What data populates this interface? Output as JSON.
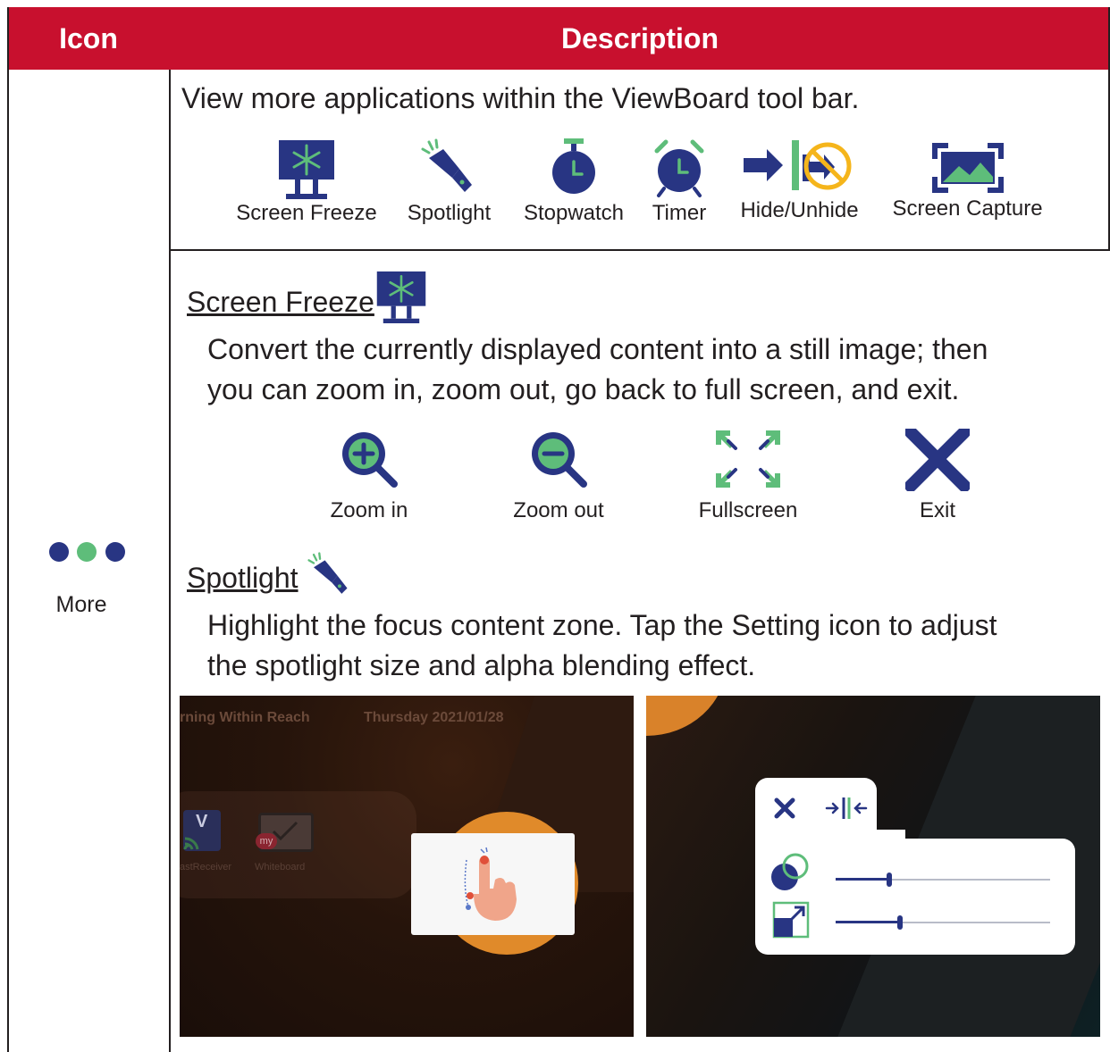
{
  "table": {
    "header_icon": "Icon",
    "header_description": "Description"
  },
  "more": {
    "label": "More",
    "icon": "three-dots-icon"
  },
  "intro": "View more applications within the ViewBoard tool bar.",
  "tools": [
    {
      "label": "Screen Freeze",
      "icon": "screen-freeze-icon"
    },
    {
      "label": "Spotlight",
      "icon": "spotlight-icon"
    },
    {
      "label": "Stopwatch",
      "icon": "stopwatch-icon"
    },
    {
      "label": "Timer",
      "icon": "timer-icon"
    },
    {
      "label": "Hide/Unhide",
      "icon": "hide-unhide-icon"
    },
    {
      "label": "Screen Capture",
      "icon": "screen-capture-icon"
    }
  ],
  "screen_freeze": {
    "title": "Screen Freeze",
    "line1": "Convert the currently displayed content into a still image; then",
    "line2": "you can zoom in, zoom out, go back to full screen, and exit.",
    "controls": [
      {
        "label": "Zoom in",
        "icon": "zoom-in-icon"
      },
      {
        "label": "Zoom out",
        "icon": "zoom-out-icon"
      },
      {
        "label": "Fullscreen",
        "icon": "fullscreen-icon"
      },
      {
        "label": "Exit",
        "icon": "exit-icon"
      }
    ]
  },
  "spotlight": {
    "title": "Spotlight",
    "line1": "Highlight the focus content zone. Tap the Setting icon to adjust",
    "line2": "the spotlight size and alpha blending effect.",
    "shot1": {
      "app_title": "rning Within Reach",
      "date": "Thursday 2021/01/28",
      "app1_label": "astReceiver",
      "app2_label": "Whiteboard",
      "app1_letter": "V",
      "app2_badge": "my"
    },
    "shot2": {
      "alpha_level": 0.25,
      "size_level": 0.3
    }
  },
  "colors": {
    "header_red": "#c8102e",
    "navy": "#283583",
    "green": "#5ebd7a",
    "yellow": "#f5b51b"
  }
}
